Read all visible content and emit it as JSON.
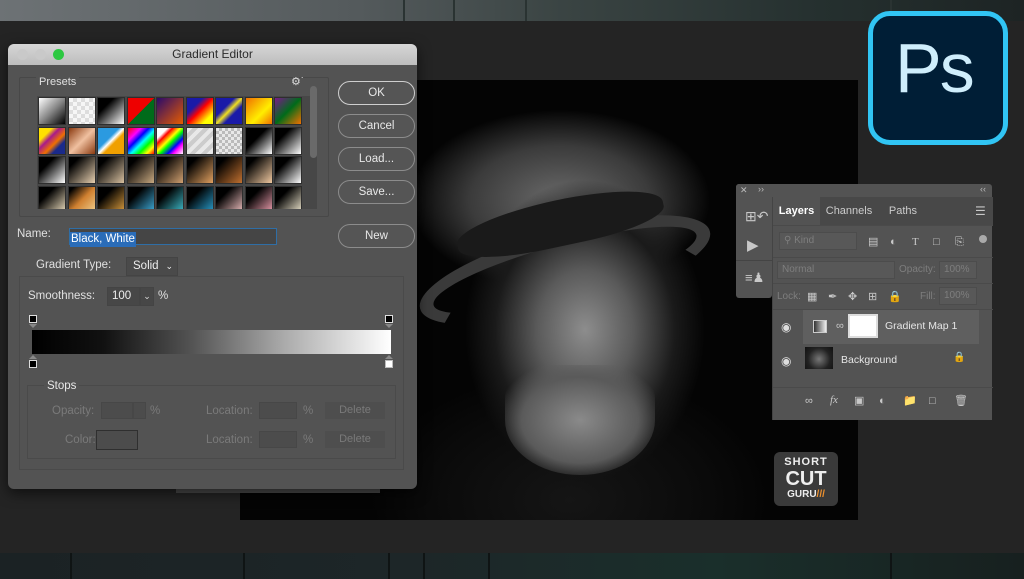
{
  "gradient_editor": {
    "title": "Gradient Editor",
    "presets_label": "Presets",
    "presets_gear_icon": "gear-icon",
    "presets": [
      [
        "linear-gradient(135deg,#fff,#888 50%,#000)",
        "repeating-conic-gradient(#ddd 0 25%,#f6f6f6 0 50%) 0 0/8px 8px",
        "linear-gradient(135deg,#000 30%,#fff)",
        "linear-gradient(135deg,#e00 50%,#006b1a 50%)",
        "linear-gradient(135deg,#2a0a6b,#e65c00)",
        "linear-gradient(135deg,#1a1aa8 30%,#f00 50%,#ff0 80%)",
        "linear-gradient(135deg,#1a1aa8 35%,#f0e020 50%,#1a1aa8 65%)",
        "linear-gradient(135deg,#f07000,#ffee00 60%,#f07000)",
        "linear-gradient(135deg,#7a1a8a,#006b1a 50%,#f07000)"
      ],
      [
        "linear-gradient(135deg,#ffe000 25%,#a81a8a 40%,#f07000 60%,#1a2a8a 75%)",
        "linear-gradient(135deg,#8a3a10,#f0c0a0 50%,#8a3a10)",
        "linear-gradient(135deg,#2b9ae0 40%,#fff 50%,#f0a000 60%)",
        "linear-gradient(135deg,#f00,#f0f 25%,#00f 40%,#0ff 55%,#0f0 70%,#ff0 85%,#f00)",
        "linear-gradient(135deg,#fff 20%,#f00 30%,#ff0 45%,#0f0 55%,#00f 70%,#f0f 80%,#fff)",
        "repeating-linear-gradient(135deg,#e8e8e8 0 4px,#ccc 4px 8px)",
        "repeating-conic-gradient(#bbb 0 25%,#e8e8e8 0 50%) 0 0/6px 6px",
        "linear-gradient(135deg,#000 40%,#fff)",
        "linear-gradient(135deg,#000 30%,#fff)"
      ],
      [
        "linear-gradient(135deg,#000 30%,#fff)",
        "linear-gradient(135deg,#000 20%,#e8d0b0)",
        "linear-gradient(135deg,#000 20%,#d8c0a0)",
        "linear-gradient(135deg,#000 20%,#c8a880)",
        "linear-gradient(135deg,#000 20%,#d0a070)",
        "linear-gradient(135deg,#000 20%,#e0a060)",
        "linear-gradient(135deg,#000 20%,#c07030)",
        "linear-gradient(135deg,#000 20%,#f0c8a0)",
        "linear-gradient(135deg,#000 30%,#fff)"
      ],
      [
        "linear-gradient(135deg,#000 30%,#f0e0c0)",
        "linear-gradient(135deg,#000 10%,#d08030 50%,#f0d090)",
        "linear-gradient(135deg,#000 30%,#e0a040)",
        "linear-gradient(135deg,#000 30%,#40b0e0)",
        "linear-gradient(135deg,#000 30%,#40c0d0)",
        "linear-gradient(135deg,#000 30%,#2aa0d0)",
        "linear-gradient(135deg,#000 30%,#f0c0c0)",
        "linear-gradient(135deg,#000 30%,#f0a0b0)",
        "linear-gradient(135deg,#000 30%,#f0e8d0)"
      ]
    ],
    "buttons": {
      "ok": "OK",
      "cancel": "Cancel",
      "load": "Load...",
      "save": "Save...",
      "new": "New"
    },
    "name_label": "Name:",
    "name_value": "Black, White",
    "gradient_type_label": "Gradient Type:",
    "gradient_type_value": "Solid",
    "smoothness_label": "Smoothness:",
    "smoothness_value": "100",
    "percent": "%",
    "gradient_stops": {
      "color_start": "#000000",
      "color_end": "#ffffff",
      "opacity_start": 100,
      "opacity_end": 100
    },
    "stops": {
      "label": "Stops",
      "opacity_label": "Opacity:",
      "color_label": "Color:",
      "location_label": "Location:",
      "delete_label": "Delete"
    }
  },
  "layers_panel": {
    "tabs": [
      "Layers",
      "Channels",
      "Paths"
    ],
    "active_tab": "Layers",
    "filter_placeholder": "Kind",
    "blend_mode": "Normal",
    "opacity_label": "Opacity:",
    "opacity_value": "100%",
    "lock_label": "Lock:",
    "fill_label": "Fill:",
    "fill_value": "100%",
    "layers": [
      {
        "name": "Gradient Map 1",
        "visible": true,
        "selected": true
      },
      {
        "name": "Background",
        "visible": true,
        "locked": true
      }
    ]
  },
  "brand": {
    "app_logo_text": "Ps",
    "app_logo_color": "#31c5f4",
    "watermark": {
      "line1": "SHORT",
      "line2": "CUT",
      "line3": "GURU"
    }
  }
}
